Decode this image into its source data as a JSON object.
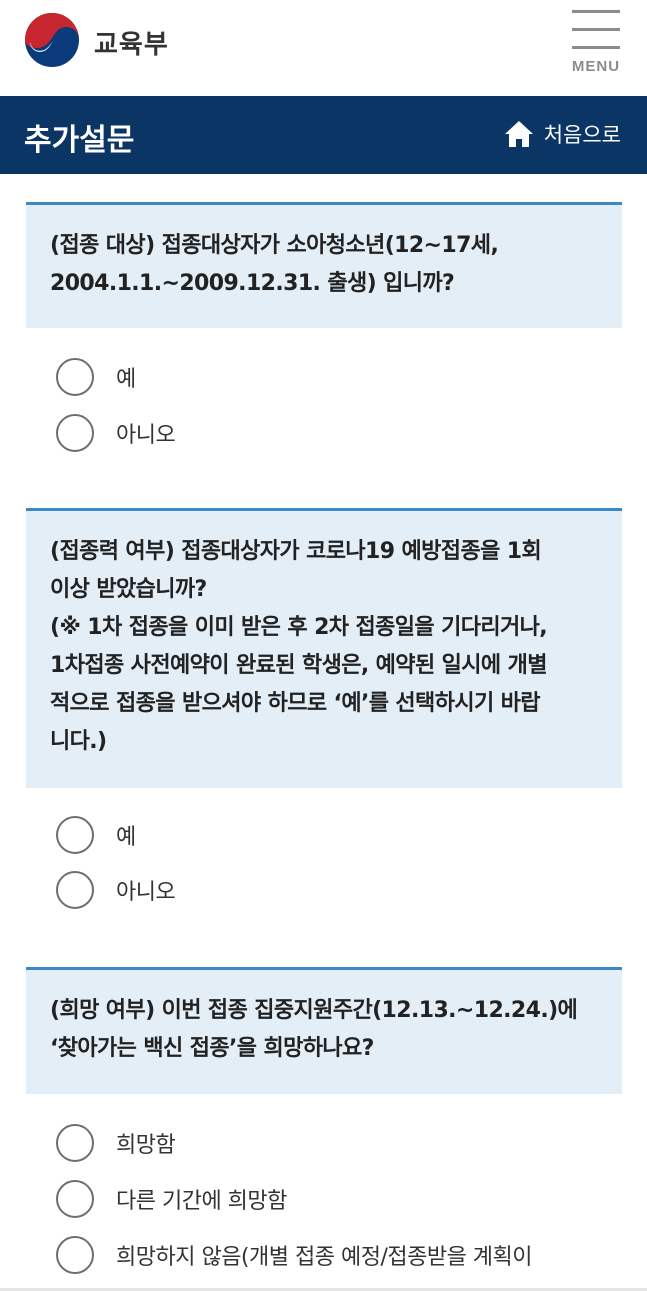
{
  "header": {
    "brand": "교육부",
    "menu_label": "MENU"
  },
  "titlebar": {
    "title": "추가설문",
    "home_label": "처음으로"
  },
  "colors": {
    "navy": "#0b3565",
    "question_bg": "#e3eef7",
    "accent_line": "#3d88c6"
  },
  "questions": [
    {
      "text": "(접종 대상) 접종대상자가 소아청소년(12~17세,\n2004.1.1.~2009.12.31. 출생) 입니까?",
      "options": [
        "예",
        "아니오"
      ]
    },
    {
      "text": "(접종력 여부) 접종대상자가 코로나19 예방접종을 1회\n이상 받았습니까?\n(※ 1차 접종을 이미 받은 후 2차 접종일을 기다리거나,\n1차접종 사전예약이 완료된 학생은, 예약된 일시에 개별\n적으로 접종을 받으셔야 하므로 ‘예’를 선택하시기 바랍\n니다.)",
      "options": [
        "예",
        "아니오"
      ]
    },
    {
      "text": "(희망 여부) 이번 접종 집중지원주간(12.13.~12.24.)에\n‘찾아가는 백신 접종’을 희망하나요?",
      "options": [
        "희망함",
        "다른 기간에 희망함",
        "희망하지 않음(개별 접종 예정/접종받을 계획이"
      ]
    }
  ]
}
